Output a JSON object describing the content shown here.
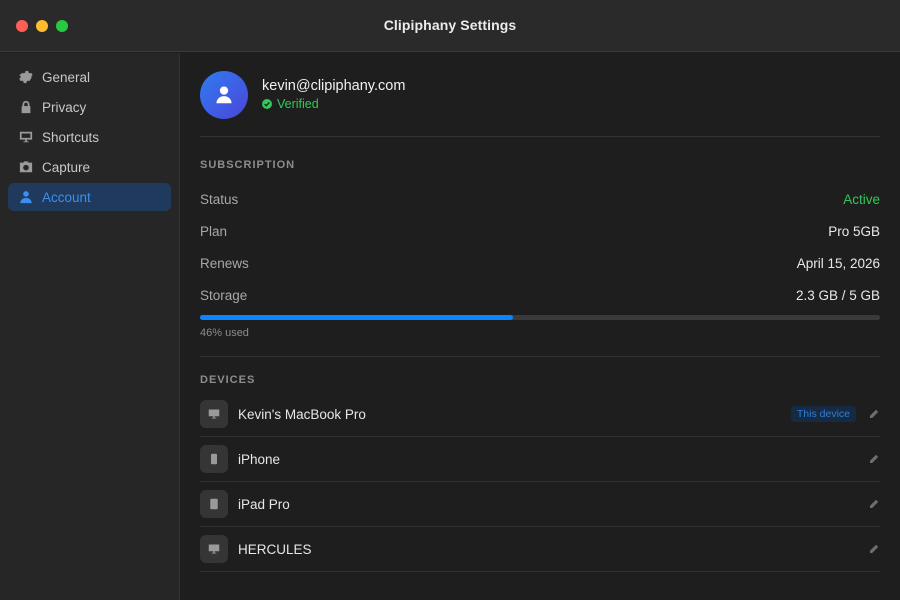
{
  "window": {
    "title": "Clipiphany Settings"
  },
  "sidebar": {
    "items": [
      {
        "label": "General",
        "icon": "gear-icon"
      },
      {
        "label": "Privacy",
        "icon": "lock-icon"
      },
      {
        "label": "Shortcuts",
        "icon": "monitor-icon"
      },
      {
        "label": "Capture",
        "icon": "camera-icon"
      },
      {
        "label": "Account",
        "icon": "person-icon",
        "active": true
      }
    ]
  },
  "profile": {
    "email": "kevin@clipiphany.com",
    "verified_label": "Verified",
    "avatar_icon": "person-icon"
  },
  "subscription": {
    "title": "SUBSCRIPTION",
    "status_label": "Status",
    "status_value": "Active",
    "plan_label": "Plan",
    "plan_value": "Pro 5GB",
    "renews_label": "Renews",
    "renews_value": "April 15, 2026",
    "storage_label": "Storage",
    "storage_value": "2.3 GB / 5 GB",
    "storage_fraction": 0.46,
    "usage_note": "46% used"
  },
  "devices": {
    "title": "DEVICES",
    "items": [
      {
        "name": "Kevin's MacBook Pro",
        "icon": "monitor-icon",
        "badge": "This device"
      },
      {
        "name": "iPhone",
        "icon": "phone-icon"
      },
      {
        "name": "iPad Pro",
        "icon": "tablet-icon"
      },
      {
        "name": "HERCULES",
        "icon": "monitor-icon"
      }
    ]
  },
  "colors": {
    "accent": "#0a84ff",
    "active_green": "#34c759",
    "sidebar_active_bg": "#1f3a5c"
  }
}
